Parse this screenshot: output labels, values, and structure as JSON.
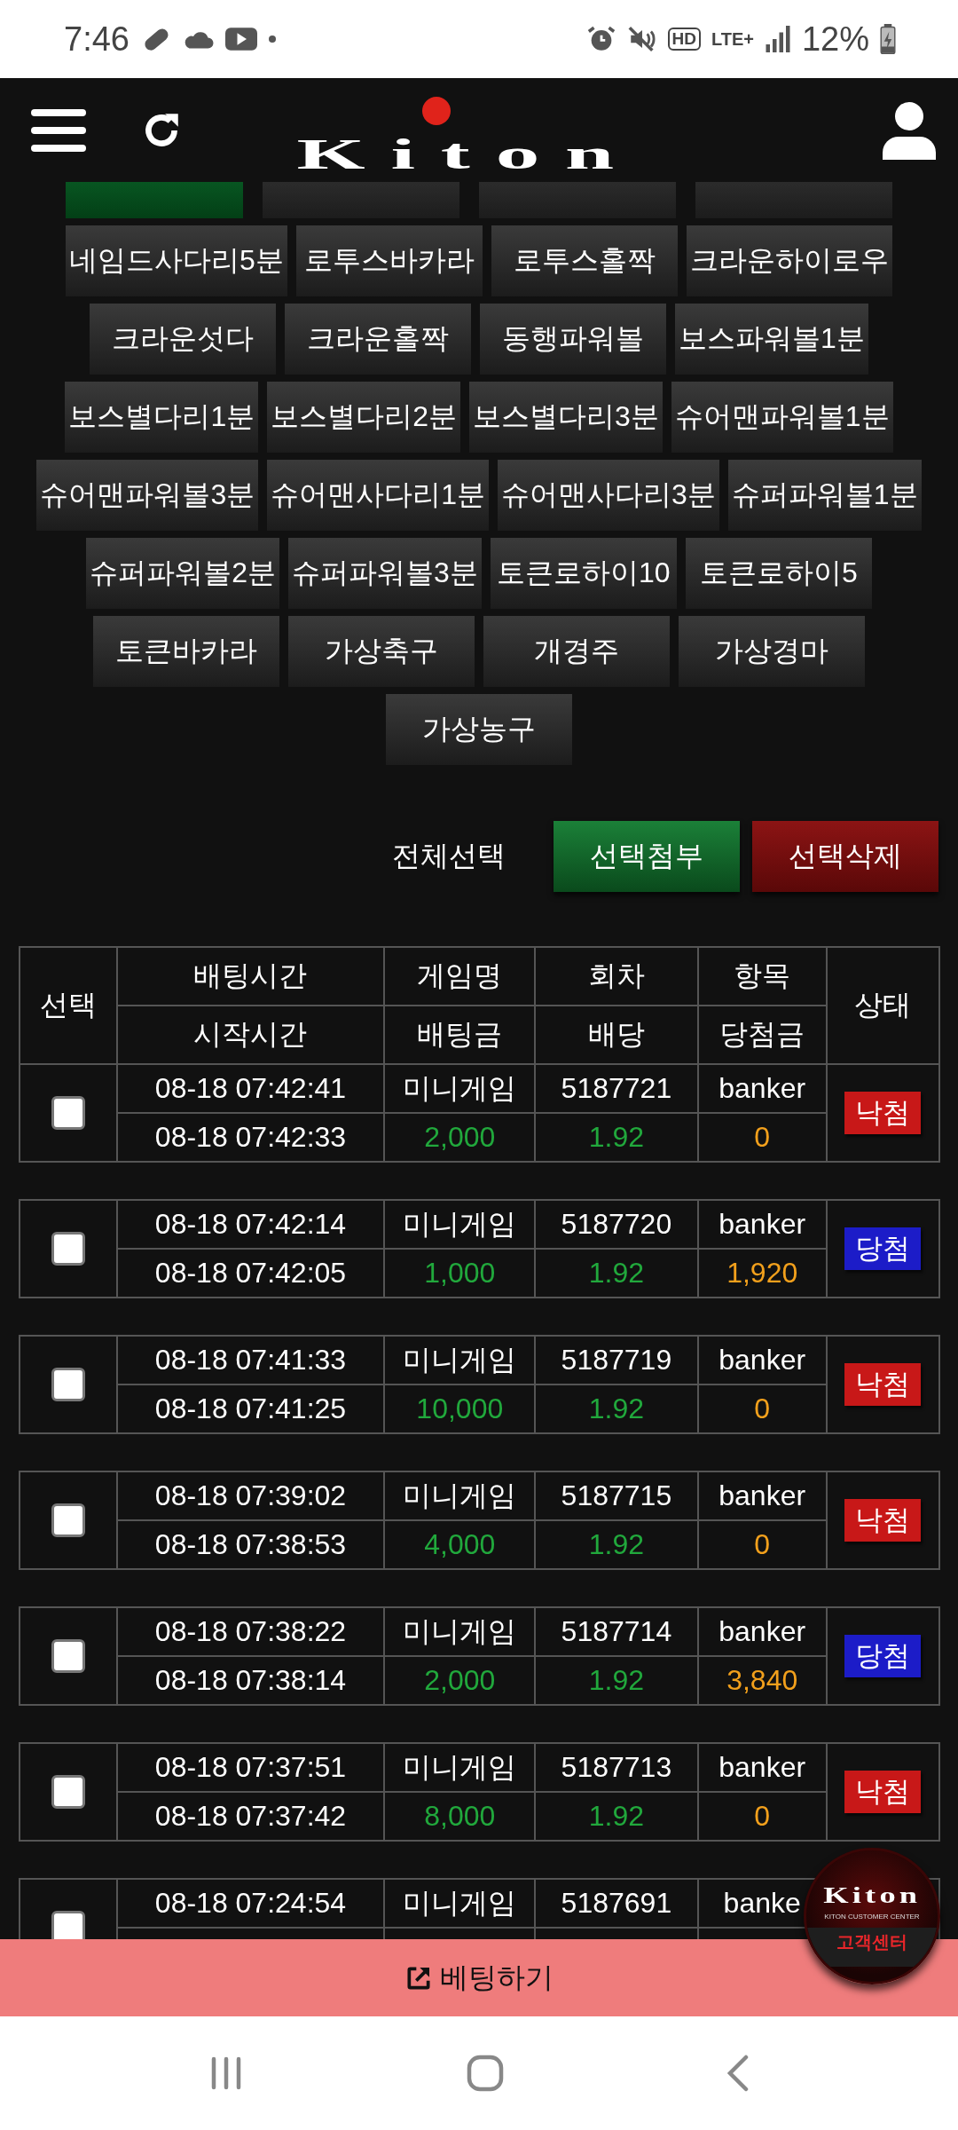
{
  "status_bar": {
    "time": "7:46",
    "hd": "HD",
    "network": "LTE+",
    "battery": "12%"
  },
  "header": {
    "logo": "Kiton"
  },
  "games": [
    {
      "selected": true
    },
    {
      "selected": false
    },
    {
      "selected": false
    },
    {
      "selected": false
    },
    {
      "label": "네임드사다리5분",
      "selected": false
    },
    {
      "label": "로투스바카라",
      "selected": false
    },
    {
      "label": "로투스홀짝",
      "selected": false
    },
    {
      "label": "크라운하이로우",
      "selected": false
    },
    {
      "label": "크라운섯다",
      "selected": false
    },
    {
      "label": "크라운홀짝",
      "selected": false
    },
    {
      "label": "동행파워볼",
      "selected": false
    },
    {
      "label": "보스파워볼1분",
      "selected": false
    },
    {
      "label": "보스별다리1분",
      "selected": false
    },
    {
      "label": "보스별다리2분",
      "selected": false
    },
    {
      "label": "보스별다리3분",
      "selected": false
    },
    {
      "label": "슈어맨파워볼1분",
      "selected": false
    },
    {
      "label": "슈어맨파워볼3분",
      "selected": false
    },
    {
      "label": "슈어맨사다리1분",
      "selected": false
    },
    {
      "label": "슈어맨사다리3분",
      "selected": false
    },
    {
      "label": "슈퍼파워볼1분",
      "selected": false
    },
    {
      "label": "슈퍼파워볼2분",
      "selected": false
    },
    {
      "label": "슈퍼파워볼3분",
      "selected": false
    },
    {
      "label": "토큰로하이10",
      "selected": false
    },
    {
      "label": "토큰로하이5",
      "selected": false
    },
    {
      "label": "토큰바카라",
      "selected": false
    },
    {
      "label": "가상축구",
      "selected": false
    },
    {
      "label": "개경주",
      "selected": false
    },
    {
      "label": "가상경마",
      "selected": false
    },
    {
      "label": "가상농구",
      "selected": false
    }
  ],
  "actions": {
    "select_all": "전체선택",
    "attach": "선택첨부",
    "delete": "선택삭제"
  },
  "table": {
    "columns": [
      {
        "top": "선택"
      },
      {
        "top": "배팅시간",
        "bottom": "시작시간"
      },
      {
        "top": "게임명",
        "bottom": "배팅금"
      },
      {
        "top": "회차",
        "bottom": "배당"
      },
      {
        "top": "항목",
        "bottom": "당첨금"
      },
      {
        "top": "상태"
      }
    ],
    "rows": [
      {
        "checked": false,
        "bet_time": "08-18 07:42:41",
        "start_time": "08-18 07:42:33",
        "game": "미니게임",
        "amount": "2,000",
        "round": "5187721",
        "odds": "1.92",
        "pick": "banker",
        "payout": "0",
        "status": "낙첨",
        "color": "#c81818"
      },
      {
        "checked": false,
        "bet_time": "08-18 07:42:14",
        "start_time": "08-18 07:42:05",
        "game": "미니게임",
        "amount": "1,000",
        "round": "5187720",
        "odds": "1.92",
        "pick": "banker",
        "payout": "1,920",
        "status": "당첨",
        "color": "#1c1cc8"
      },
      {
        "checked": false,
        "bet_time": "08-18 07:41:33",
        "start_time": "08-18 07:41:25",
        "game": "미니게임",
        "amount": "10,000",
        "round": "5187719",
        "odds": "1.92",
        "pick": "banker",
        "payout": "0",
        "status": "낙첨",
        "color": "#c81818"
      },
      {
        "checked": false,
        "bet_time": "08-18 07:39:02",
        "start_time": "08-18 07:38:53",
        "game": "미니게임",
        "amount": "4,000",
        "round": "5187715",
        "odds": "1.92",
        "pick": "banker",
        "payout": "0",
        "status": "낙첨",
        "color": "#c81818"
      },
      {
        "checked": false,
        "bet_time": "08-18 07:38:22",
        "start_time": "08-18 07:38:14",
        "game": "미니게임",
        "amount": "2,000",
        "round": "5187714",
        "odds": "1.92",
        "pick": "banker",
        "payout": "3,840",
        "status": "당첨",
        "color": "#1c1cc8"
      },
      {
        "checked": false,
        "bet_time": "08-18 07:37:51",
        "start_time": "08-18 07:37:42",
        "game": "미니게임",
        "amount": "8,000",
        "round": "5187713",
        "odds": "1.92",
        "pick": "banker",
        "payout": "0",
        "status": "낙첨",
        "color": "#c81818"
      },
      {
        "checked": false,
        "bet_time": "08-18 07:24:54",
        "game": "미니게임",
        "round": "5187691",
        "pick": "banke"
      }
    ]
  },
  "customer_center": {
    "logo": "Kiton",
    "subtitle": "KITON CUSTOMER CENTER",
    "label": "고객센터"
  },
  "bottom_bar": {
    "label": "베팅하기"
  }
}
